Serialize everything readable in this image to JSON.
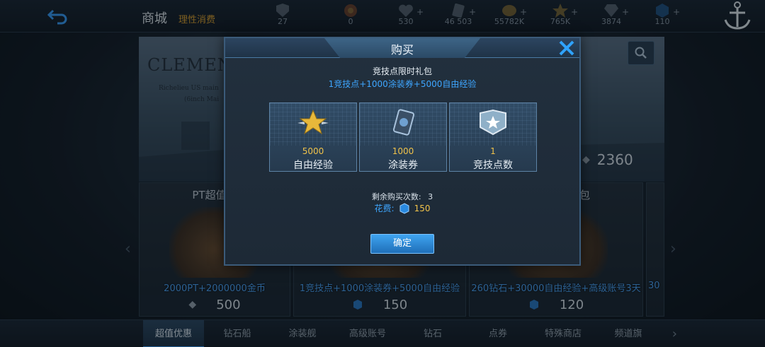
{
  "topbar": {
    "back_icon": "back-arrow-icon",
    "shop_title": "商城",
    "sub_title": "理性消费",
    "resources": [
      {
        "icon": "rank-badge-icon",
        "value": "27"
      },
      {
        "icon": "treasure-icon",
        "value": "0"
      },
      {
        "icon": "heart-icon",
        "value": ""
      },
      {
        "icon": "skin-ticket-icon",
        "value": "46 503"
      },
      {
        "icon": "gold-coin-icon",
        "value": "55782K"
      },
      {
        "icon": "star-exp-icon",
        "value": "765K"
      },
      {
        "icon": "diamond-icon",
        "value": "3874"
      },
      {
        "icon": "blue-gem-icon",
        "value": "110"
      }
    ],
    "heart_value": "530"
  },
  "banner": {
    "title": "CLEMEN",
    "line1": "Richelieu US main",
    "line2": "(6inch Mai",
    "price": "2360"
  },
  "cards": [
    {
      "title": "PT超值礼",
      "desc": "2000PT+2000000金币",
      "price": "500"
    },
    {
      "title": "",
      "desc": "1竞技点+1000涂装券+5000自由经验",
      "price": "150"
    },
    {
      "title": "包",
      "desc": "260钻石+30000自由经验+高级账号3天",
      "price": "120"
    },
    {
      "title": "",
      "desc": "30",
      "price": ""
    }
  ],
  "tabs": [
    "超值优惠",
    "钻石船",
    "涂装舰",
    "高级账号",
    "钻石",
    "点券",
    "特殊商店",
    "频道旗"
  ],
  "modal": {
    "title": "购买",
    "pack_name": "竞技点限时礼包",
    "pack_desc": "1竞技点+1000涂装券+5000自由经验",
    "items": [
      {
        "icon": "gold-star-icon",
        "count": "5000",
        "name": "自由经验"
      },
      {
        "icon": "skin-ticket-icon",
        "count": "1000",
        "name": "涂装券"
      },
      {
        "icon": "arena-badge-icon",
        "count": "1",
        "name": "竞技点数"
      }
    ],
    "remain_label": "剩余购买次数:",
    "remain_value": "3",
    "cost_label": "花费:",
    "cost_value": "150",
    "confirm_label": "确定"
  }
}
